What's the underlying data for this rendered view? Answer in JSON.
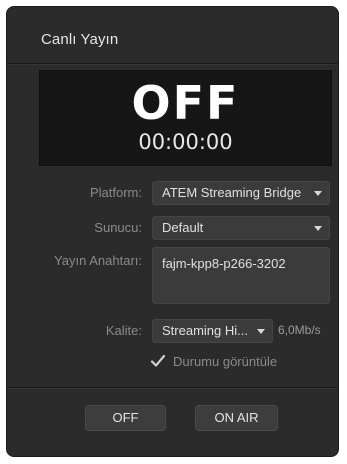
{
  "panel": {
    "title": "Canlı Yayın"
  },
  "status": {
    "word": "OFF",
    "timer": "00:00:00"
  },
  "form": {
    "platform_label": "Platform:",
    "platform_value": "ATEM Streaming Bridge",
    "server_label": "Sunucu:",
    "server_value": "Default",
    "key_label": "Yayın Anahtarı:",
    "key_value": "fajm-kpp8-p266-3202",
    "quality_label": "Kalite:",
    "quality_value": "Streaming Hi...",
    "bitrate": "6,0Mb/s",
    "show_status_label": "Durumu görüntüle",
    "show_status_checked": true
  },
  "buttons": {
    "off_label": "OFF",
    "on_air_label": "ON AIR"
  },
  "colors": {
    "panel_bg": "#2b2b2b",
    "status_bg": "#161616",
    "field_bg": "#3b3b3b"
  }
}
